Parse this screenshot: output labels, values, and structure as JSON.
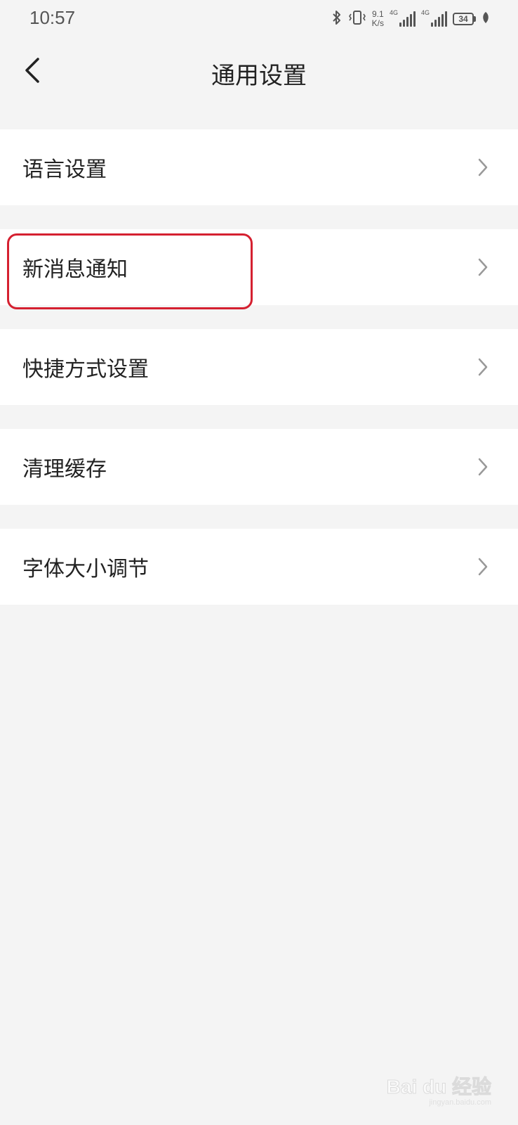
{
  "status_bar": {
    "time": "10:57",
    "net_speed_value": "9.1",
    "net_speed_unit": "K/s",
    "signal_1_label": "4G",
    "signal_2_label": "4G",
    "battery_level": "34",
    "icons": [
      "bluetooth-icon",
      "vibrate-icon",
      "signal-icon",
      "battery-icon",
      "leaf-icon"
    ]
  },
  "header": {
    "title": "通用设置",
    "back_icon": "chevron-left-icon"
  },
  "settings": {
    "items": [
      {
        "label": "语言设置"
      },
      {
        "label": "新消息通知"
      },
      {
        "label": "快捷方式设置"
      },
      {
        "label": "清理缓存"
      },
      {
        "label": "字体大小调节"
      }
    ],
    "highlighted_item": "新消息通知",
    "highlight_color": "#d52030"
  },
  "watermark": {
    "main": "Bai du 经验",
    "sub": "jingyan.baidu.com"
  }
}
